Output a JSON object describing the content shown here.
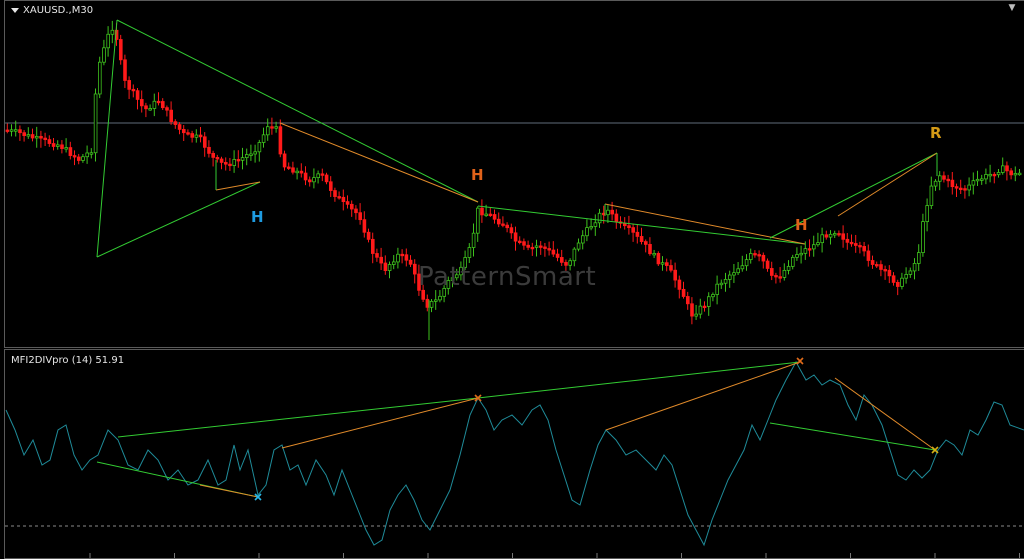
{
  "window": {
    "symbol_title": "XAUUSD.,M30",
    "indicator_title": "MFI2DIVpro (14) 51.91",
    "watermark": "PatternSmart"
  },
  "pattern_labels": [
    {
      "text": "H",
      "color": "#1e9be0"
    },
    {
      "text": "H",
      "color": "#e0621a"
    },
    {
      "text": "H",
      "color": "#e0621a"
    },
    {
      "text": "R",
      "color": "#d49a16"
    }
  ],
  "colors": {
    "bull_candle": "#3ec21d",
    "bear_candle": "#ff1a1a",
    "pattern_line_green": "#33cc33",
    "pattern_line_orange": "#e08a2a",
    "indicator_line": "#1f8c9a",
    "divergence_green": "#33cc33",
    "divergence_orange": "#e08a2a",
    "cross_cyan": "#29b6e6",
    "cross_orange": "#e06b1a",
    "cross_yellow": "#d4b016",
    "level_line": "#5f6b7a"
  },
  "icons": {
    "menu": "triangle-down-icon",
    "close": "close-icon"
  }
}
